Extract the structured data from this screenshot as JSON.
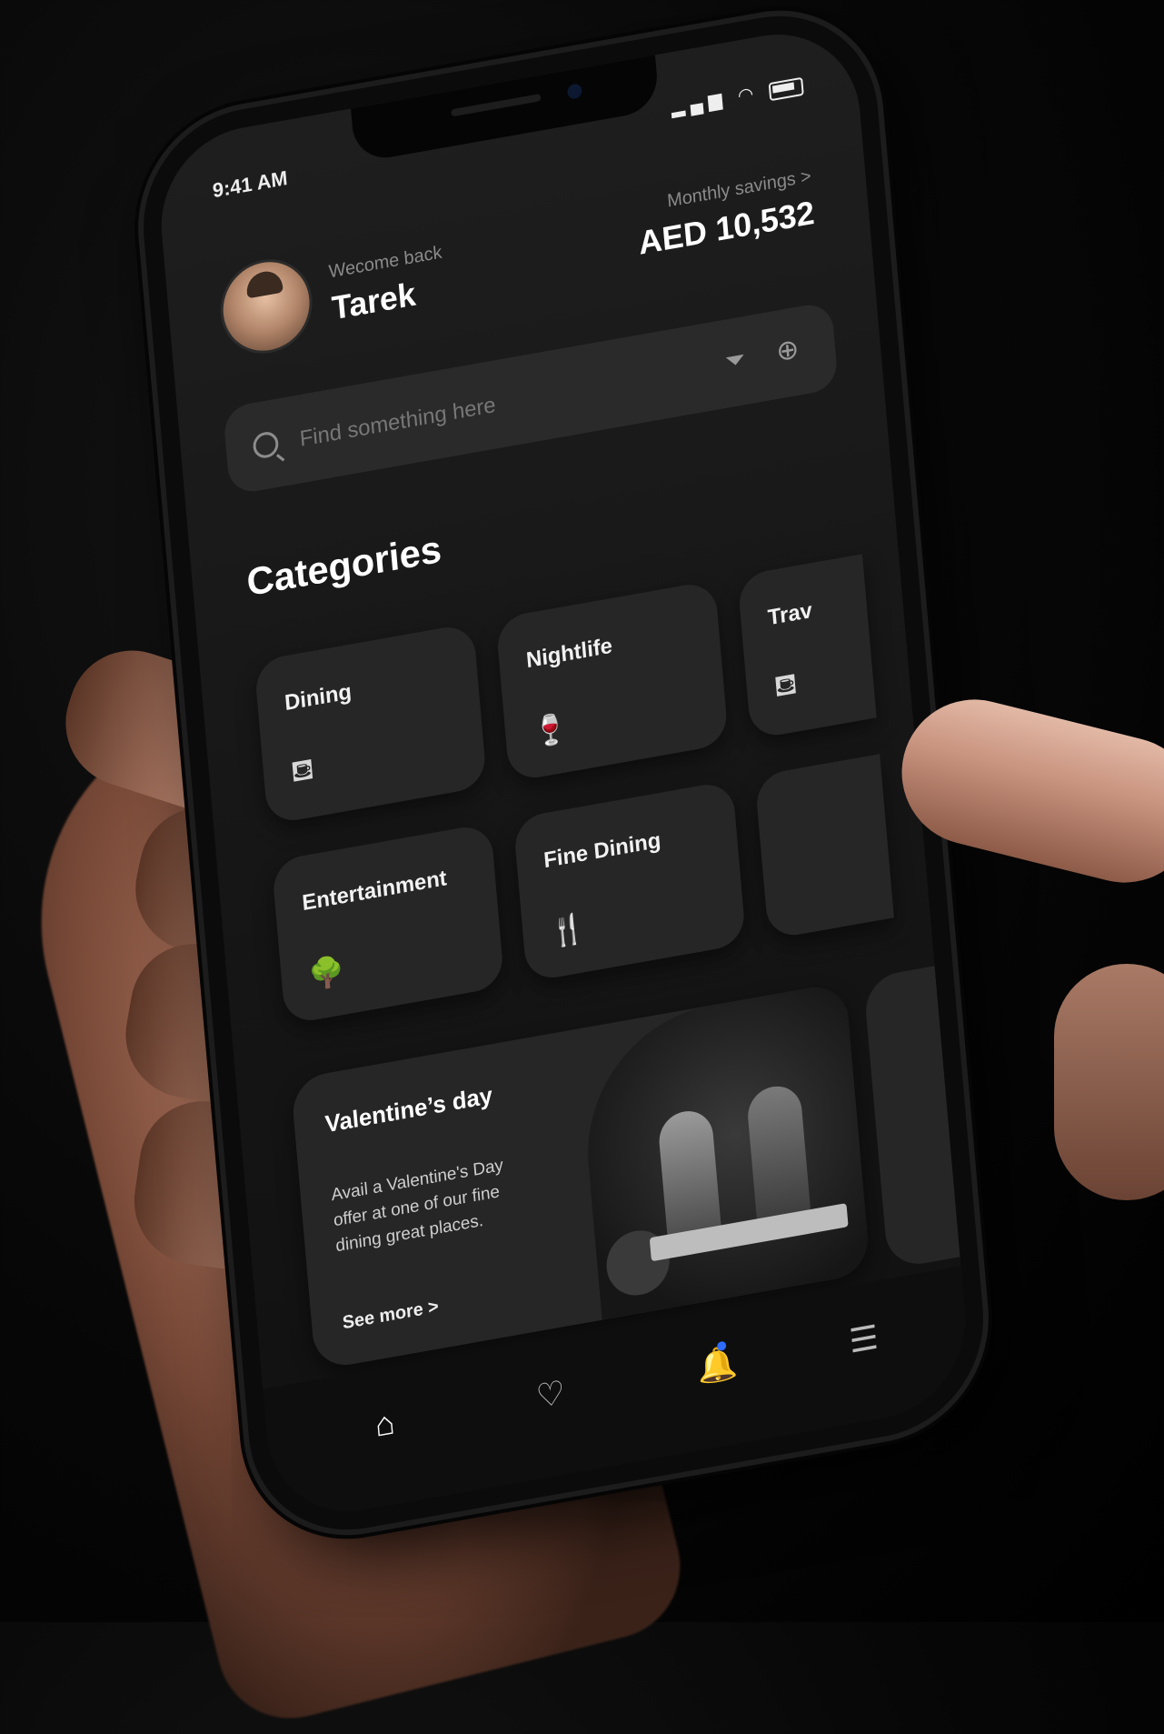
{
  "status_bar": {
    "time": "9:41 AM",
    "signal_icon": "signal-icon",
    "wifi_icon": "wifi-icon",
    "battery_icon": "battery-icon"
  },
  "header": {
    "welcome": "Wecome back",
    "username": "Tarek",
    "savings_label": "Monthly savings >",
    "savings_amount": "AED 10,532"
  },
  "search": {
    "placeholder": "Find something here",
    "value": ""
  },
  "categories": {
    "title": "Categories",
    "items": [
      {
        "label": "Dining",
        "icon": "dining-icon",
        "glyph": "⛾"
      },
      {
        "label": "Nightlife",
        "icon": "wine-glass-icon",
        "glyph": "🍷"
      },
      {
        "label": "Trav",
        "icon": "travel-icon",
        "glyph": "⛾"
      },
      {
        "label": "Entertainment",
        "icon": "trees-icon",
        "glyph": "🌳"
      },
      {
        "label": "Fine Dining",
        "icon": "cutlery-icon",
        "glyph": "🍴"
      },
      {
        "label": "",
        "icon": "partial-icon",
        "glyph": ""
      }
    ]
  },
  "promo": {
    "title": "Valentine’s day",
    "description": "Avail a Valentine's Day offer at one of our fine dining great places.",
    "link": "See more >"
  },
  "tabbar": {
    "home_icon": "home-icon",
    "favorites_icon": "heart-icon",
    "notifications_icon": "bell-icon",
    "menu_icon": "menu-icon",
    "accent": "#2f6bff"
  },
  "colors": {
    "background": "#000000",
    "screen": "#1a1a1a",
    "card": "#262626",
    "text_primary": "#ffffff",
    "text_secondary": "#8a8a8a"
  }
}
